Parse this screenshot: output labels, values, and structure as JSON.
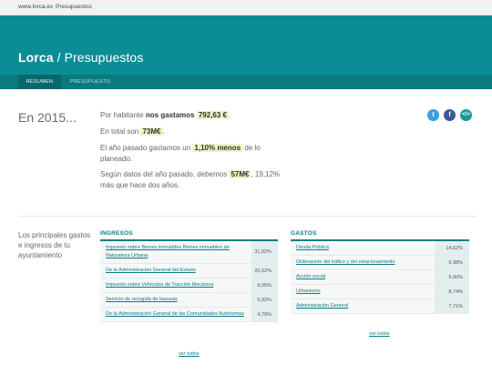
{
  "topbar": {
    "site": "www.lorca.es",
    "section": "Presupuestos"
  },
  "header": {
    "brand": "Lorca",
    "separator": " / ",
    "title": "Presupuestos"
  },
  "tabs": [
    {
      "label": "RESUMEN"
    },
    {
      "label": "PRESUPUESTO"
    }
  ],
  "summary": {
    "year": "En 2015...",
    "line1_pre": "Por habitante ",
    "line1_bold": "nos gastamos",
    "line1_value": "792,63 €",
    "line1_post": ".",
    "line2_pre": "En total son ",
    "line2_value": "73M€",
    "line2_post": ".",
    "line3_pre": "El año pasado gastamos un ",
    "line3_value": "1,10% menos",
    "line3_post": " de lo planeado.",
    "line4_pre": "Según datos del año pasado, debemos ",
    "line4_value": "57M€",
    "line4_post": ", 19,12% más que hace dos años."
  },
  "share": {
    "twitter": "t",
    "facebook": "f",
    "embed": "</>"
  },
  "intro": "Los principales gastos e ingresos de tu ayuntamiento",
  "ingresos": {
    "title": "INGRESOS",
    "rows": [
      {
        "name": "Impuesto sobre Bienes Inmuebles Bienes inmuebles de Naturaleza Urbana",
        "pct": "31,02%"
      },
      {
        "name": "De la Administración General del Estado",
        "pct": "20,52%"
      },
      {
        "name": "Impuesto sobre Vehículos de Tracción Mecánica",
        "pct": "8,05%"
      },
      {
        "name": "Servicio de recogida de basuras",
        "pct": "5,92%"
      },
      {
        "name": "De la Administración General de las Comunidades Autónomas",
        "pct": "4,79%"
      }
    ],
    "see_all": "ver todos"
  },
  "gastos": {
    "title": "GASTOS",
    "rows": [
      {
        "name": "Deuda Pública",
        "pct": "14,62%"
      },
      {
        "name": "Ordenación del tráfico y del estacionamiento",
        "pct": "9,98%"
      },
      {
        "name": "Acción social",
        "pct": "9,00%"
      },
      {
        "name": "Urbanismo",
        "pct": "8,74%"
      },
      {
        "name": "Administración General",
        "pct": "7,71%"
      }
    ],
    "see_all": "ver todos"
  },
  "colors": {
    "brand": "#0b8d96",
    "tabs": "#0a7980",
    "highlight": "#eef3c4",
    "link": "#0b7a82"
  }
}
